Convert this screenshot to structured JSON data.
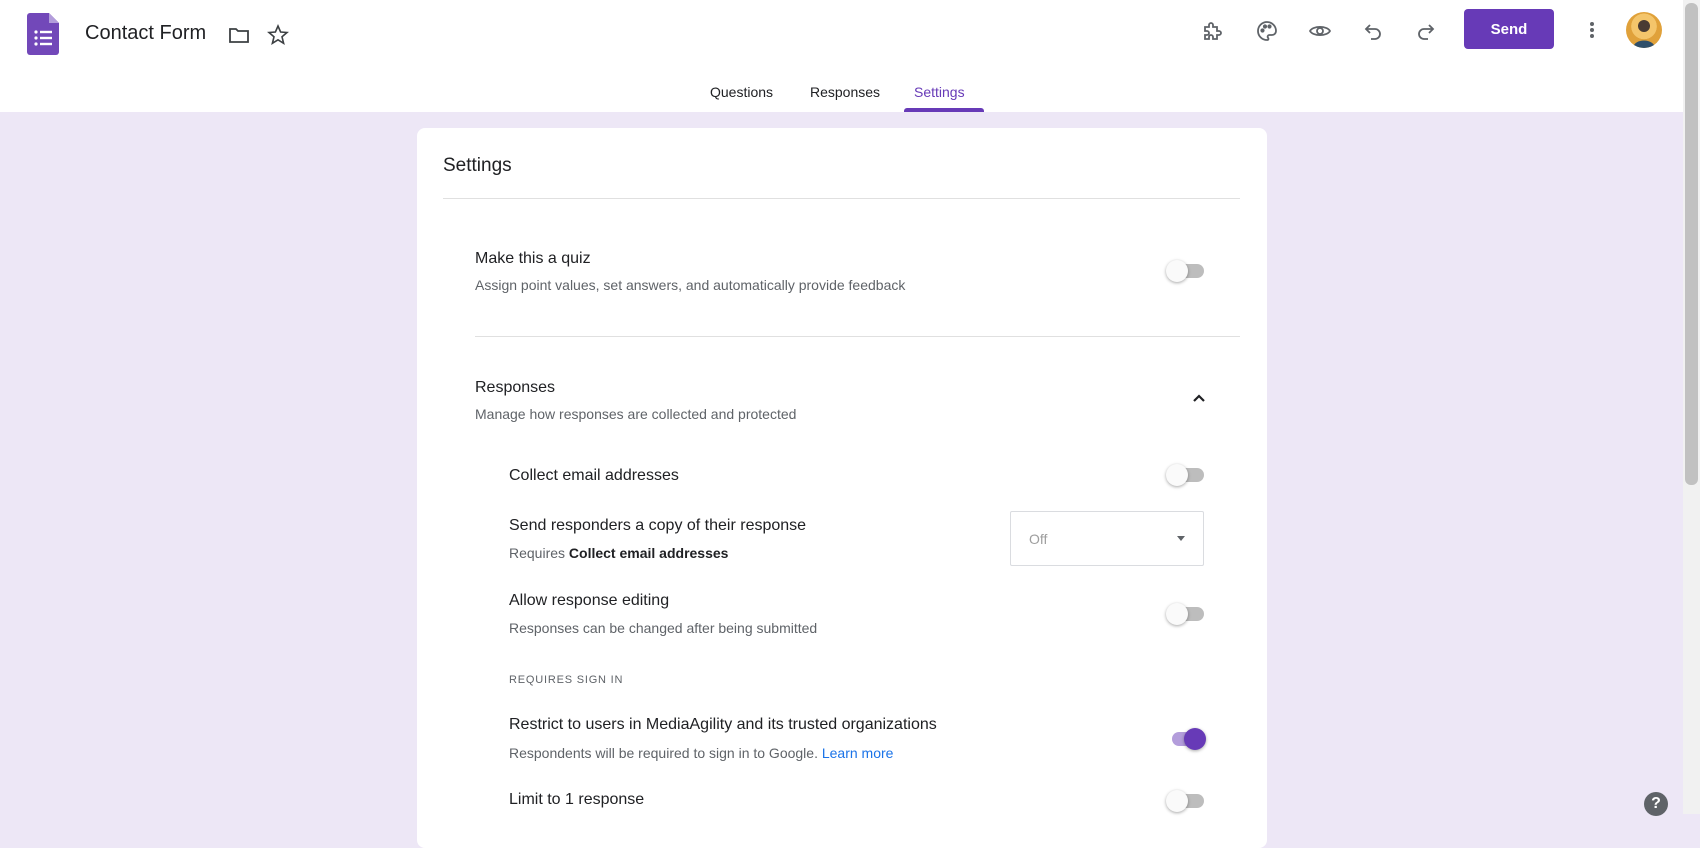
{
  "header": {
    "title": "Contact Form",
    "send_label": "Send"
  },
  "tabs": [
    {
      "label": "Questions"
    },
    {
      "label": "Responses"
    },
    {
      "label": "Settings"
    }
  ],
  "colors": {
    "accent": "#673ab7",
    "background": "#ede7f6",
    "link": "#1a73e8"
  },
  "settings": {
    "title": "Settings",
    "quiz": {
      "title": "Make this a quiz",
      "subtitle": "Assign point values, set answers, and automatically provide feedback",
      "enabled": false
    },
    "responses": {
      "title": "Responses",
      "subtitle": "Manage how responses are collected and protected",
      "expanded": true,
      "collect_emails": {
        "title": "Collect email addresses",
        "enabled": false
      },
      "send_copy": {
        "title": "Send responders a copy of their response",
        "requires_prefix": "Requires",
        "requires_bold": "Collect email addresses",
        "selected": "Off"
      },
      "allow_editing": {
        "title": "Allow response editing",
        "subtitle": "Responses can be changed after being submitted",
        "enabled": false
      },
      "requires_sign_in_label": "REQUIRES SIGN IN",
      "restrict_users": {
        "title": "Restrict to users in MediaAgility and its trusted organizations",
        "subtitle": "Respondents will be required to sign in to Google.",
        "learn_more": "Learn more",
        "enabled": true
      },
      "limit_one": {
        "title": "Limit to 1 response",
        "enabled": false
      }
    }
  },
  "icons": {
    "app_logo": "forms-logo-icon",
    "folder": "folder-icon",
    "star": "star-icon",
    "addons": "puzzle-icon",
    "theme": "palette-icon",
    "preview": "eye-icon",
    "undo": "undo-icon",
    "redo": "redo-icon",
    "more": "more-vert-icon",
    "help": "help-icon"
  },
  "help_glyph": "?"
}
